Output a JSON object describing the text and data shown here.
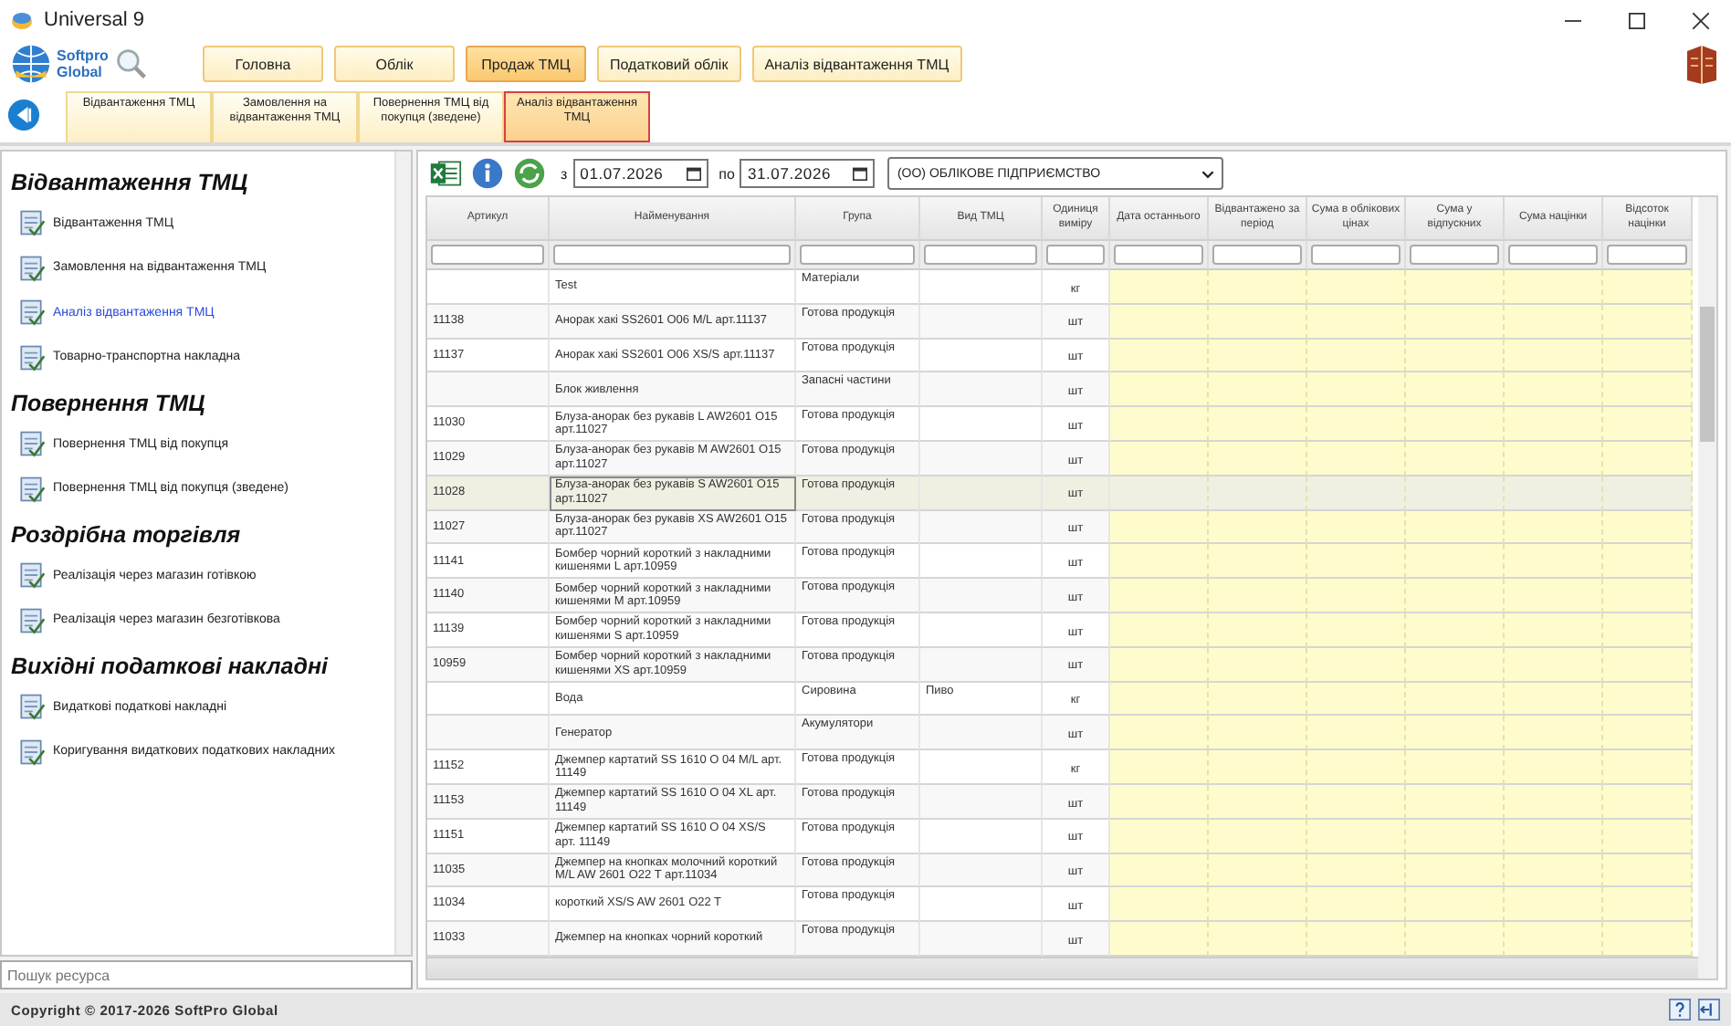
{
  "window": {
    "title": "Universal 9"
  },
  "logo": {
    "text": "Softpro Global"
  },
  "nav_tabs": [
    {
      "label": "Головна",
      "selected": false
    },
    {
      "label": "Облік",
      "selected": false
    },
    {
      "label": "Продаж ТМЦ",
      "selected": true
    },
    {
      "label": "Податковий облік",
      "selected": false
    },
    {
      "label": "Аналіз відвантаження ТМЦ",
      "selected": false
    }
  ],
  "sub_tabs": [
    {
      "label": "Відвантаження ТМЦ",
      "selected": false
    },
    {
      "label": "Замовлення на відвантаження ТМЦ",
      "selected": false
    },
    {
      "label": "Повернення ТМЦ від покупця (зведене)",
      "selected": false
    },
    {
      "label": "Аналіз відвантаження ТМЦ",
      "selected": true
    }
  ],
  "sidebar": {
    "sections": [
      {
        "title": "Відвантаження ТМЦ",
        "items": [
          {
            "label": "Відвантаження ТМЦ",
            "selected": false
          },
          {
            "label": "Замовлення на відвантаження ТМЦ",
            "selected": false
          },
          {
            "label": "Аналіз відвантаження ТМЦ",
            "selected": true
          },
          {
            "label": "Товарно-транспортна накладна",
            "selected": false
          }
        ]
      },
      {
        "title": "Повернення ТМЦ",
        "items": [
          {
            "label": "Повернення ТМЦ від покупця",
            "selected": false
          },
          {
            "label": "Повернення ТМЦ від покупця (зведене)",
            "selected": false
          }
        ]
      },
      {
        "title": "Роздрібна торгівля",
        "items": [
          {
            "label": "Реалізація через магазин готівкою",
            "selected": false
          },
          {
            "label": "Реалізація через магазин безготівкова",
            "selected": false
          }
        ]
      },
      {
        "title": "Вихідні податкові накладні",
        "items": [
          {
            "label": "Видаткові податкові накладні",
            "selected": false
          },
          {
            "label": "Коригування видаткових податкових накладних",
            "selected": false
          }
        ]
      }
    ],
    "search": {
      "placeholder": "Пошук ресурса"
    }
  },
  "toolbar": {
    "from_label": "з",
    "from_date": "01.07.2026",
    "to_label": "по",
    "to_date": "31.07.2026",
    "company": "(ОО) ОБЛІКОВЕ ПІДПРИЄМСТВО"
  },
  "table": {
    "columns": [
      "Артикул",
      "Найменування",
      "Група",
      "Вид ТМЦ",
      "Одиниця виміру",
      "Дата останнього",
      "Відвантажено за період",
      "Сума в облікових цінах",
      "Сума у відпускних",
      "Сума націнки",
      "Відсоток націнки"
    ],
    "rows": [
      {
        "article": "",
        "name": "Test",
        "group": "Матеріали",
        "kind": "",
        "unit": "кг",
        "selected": false
      },
      {
        "article": "11138",
        "name": "Анорак хакі SS2601 O06 M/L арт.11137",
        "group": "Готова продукція",
        "kind": "",
        "unit": "шт",
        "selected": false
      },
      {
        "article": "11137",
        "name": "Анорак хакі SS2601 O06 XS/S арт.11137",
        "group": "Готова продукція",
        "kind": "",
        "unit": "шт",
        "selected": false
      },
      {
        "article": "",
        "name": "Блок живлення",
        "group": "Запасні частини",
        "kind": "",
        "unit": "шт",
        "selected": false
      },
      {
        "article": "11030",
        "name": "Блуза-анорак без рукавів L AW2601 O15 арт.11027",
        "group": "Готова продукція",
        "kind": "",
        "unit": "шт",
        "selected": false
      },
      {
        "article": "11029",
        "name": "Блуза-анорак без рукавів M AW2601 O15 арт.11027",
        "group": "Готова продукція",
        "kind": "",
        "unit": "шт",
        "selected": false
      },
      {
        "article": "11028",
        "name": "Блуза-анорак без рукавів S AW2601 O15 арт.11027",
        "group": "Готова продукція",
        "kind": "",
        "unit": "шт",
        "selected": true
      },
      {
        "article": "11027",
        "name": "Блуза-анорак без рукавів XS AW2601 O15 арт.11027",
        "group": "Готова продукція",
        "kind": "",
        "unit": "шт",
        "selected": false
      },
      {
        "article": "11141",
        "name": "Бомбер чорний короткий з накладними кишенями L арт.10959",
        "group": "Готова продукція",
        "kind": "",
        "unit": "шт",
        "selected": false
      },
      {
        "article": "11140",
        "name": "Бомбер чорний короткий з накладними кишенями M арт.10959",
        "group": "Готова продукція",
        "kind": "",
        "unit": "шт",
        "selected": false
      },
      {
        "article": "11139",
        "name": "Бомбер чорний короткий з накладними кишенями S арт.10959",
        "group": "Готова продукція",
        "kind": "",
        "unit": "шт",
        "selected": false
      },
      {
        "article": "10959",
        "name": "Бомбер чорний короткий з накладними кишенями XS арт.10959",
        "group": "Готова продукція",
        "kind": "",
        "unit": "шт",
        "selected": false
      },
      {
        "article": "",
        "name": "Вода",
        "group": "Сировина",
        "kind": "Пиво",
        "unit": "кг",
        "selected": false
      },
      {
        "article": "",
        "name": "Генератор",
        "group": "Акумулятори",
        "kind": "",
        "unit": "шт",
        "selected": false
      },
      {
        "article": "11152",
        "name": "Джемпер картатий SS 1610 O 04 M/L арт. 11149",
        "group": "Готова продукція",
        "kind": "",
        "unit": "кг",
        "selected": false
      },
      {
        "article": "11153",
        "name": "Джемпер картатий SS 1610 O 04 XL арт. 11149",
        "group": "Готова продукція",
        "kind": "",
        "unit": "шт",
        "selected": false
      },
      {
        "article": "11151",
        "name": "Джемпер картатий SS 1610 O 04 XS/S арт. 11149",
        "group": "Готова продукція",
        "kind": "",
        "unit": "шт",
        "selected": false
      },
      {
        "article": "11035",
        "name": "Джемпер на кнопках молочний короткий M/L AW 2601 O22 T арт.11034",
        "group": "Готова продукція",
        "kind": "",
        "unit": "шт",
        "selected": false
      },
      {
        "article": "11034",
        "name": "короткий XS/S AW 2601 O22 T",
        "group": "Готова продукція",
        "kind": "",
        "unit": "шт",
        "selected": false
      },
      {
        "article": "11033",
        "name": "Джемпер на кнопках чорний короткий",
        "group": "Готова продукція",
        "kind": "",
        "unit": "шт",
        "selected": false
      }
    ]
  },
  "status_bar": {
    "copyright": "Copyright © 2017-2026 SoftPro Global"
  }
}
